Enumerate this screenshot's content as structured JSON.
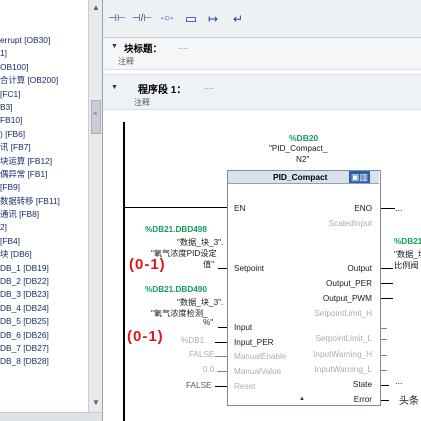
{
  "tree": {
    "items": [
      "errupt [OB30]",
      "1]",
      "OB100]",
      "合计算 [OB200]",
      "[FC1]",
      "B3]",
      "FB10]",
      ") [FB6]",
      "讯 [FB7]",
      "块运算 [FB12]",
      "偶异常 [FB1]",
      "[FB9]",
      "数据转移 [FB11]",
      "通讯 [FB8]",
      "2]",
      "[FB4]",
      "块 [DB6]",
      "DB_1 [DB19]",
      "DB_2 [DB22]",
      "DB_3 [DB23]",
      "DB_4 [DB24]",
      "DB_5 [DB25]",
      "DB_6 [DB26]",
      "DB_7 [DB27]",
      "DB_8 [DB28]"
    ]
  },
  "toolbar": {
    "btn1": "⊣⊢",
    "btn2": "⊣/⊢",
    "btn3": "-○-",
    "btn4": "▭",
    "btn5": "↦",
    "btn6": "↵"
  },
  "block": {
    "title_label": "块标题：",
    "title_dots": "....",
    "comment": "注释"
  },
  "network": {
    "label": "程序段 1：",
    "dots": "....",
    "comment": "注释"
  },
  "instance": {
    "address": "%DB20",
    "name_line1": "\"PID_Compact_",
    "name_line2": "N2\""
  },
  "fb": {
    "type": "PID_Compact",
    "badge": "▣▥",
    "en": "EN",
    "eno": "ENO",
    "setpoint": "Setpoint",
    "input": "Input",
    "input_per": "Input_PER",
    "manual_enable": "ManualEnable",
    "manual_value": "ManualValue",
    "reset": "Reset",
    "scaled_input": "ScaledInput",
    "output": "Output",
    "output_per": "Output_PER",
    "output_pwm": "Output_PWM",
    "setpoint_limit_h": "SetpointLimit_H",
    "setpoint_limit_l": "SetpointLimit_L",
    "input_warning_h": "InputWarning_H",
    "input_warning_l": "InputWarning_L",
    "state": "State",
    "error": "Error",
    "expand": "▲"
  },
  "operands": {
    "setpoint_addr": "%DB21.DBD498",
    "setpoint_name1": "\"数据_块_3\".",
    "setpoint_name2": "\"氧气浓度PID设定",
    "setpoint_name3": "值\"",
    "input_addr": "%DB21.DBD490",
    "input_name1": "\"数据_块_3\".",
    "input_name2": "\"氧气浓度检测_",
    "input_name3": "%\"",
    "input_per_val": "%DB1",
    "false1": "FALSE",
    "zero": "0.0",
    "false2": "FALSE",
    "output_addr": "%DB21",
    "output_name1": "\"数据_块_",
    "output_name2": "比例阀",
    "dots": "..."
  },
  "annotations": {
    "range1": "(0-1)",
    "range2": "(0-1)",
    "watermark": "头条"
  }
}
